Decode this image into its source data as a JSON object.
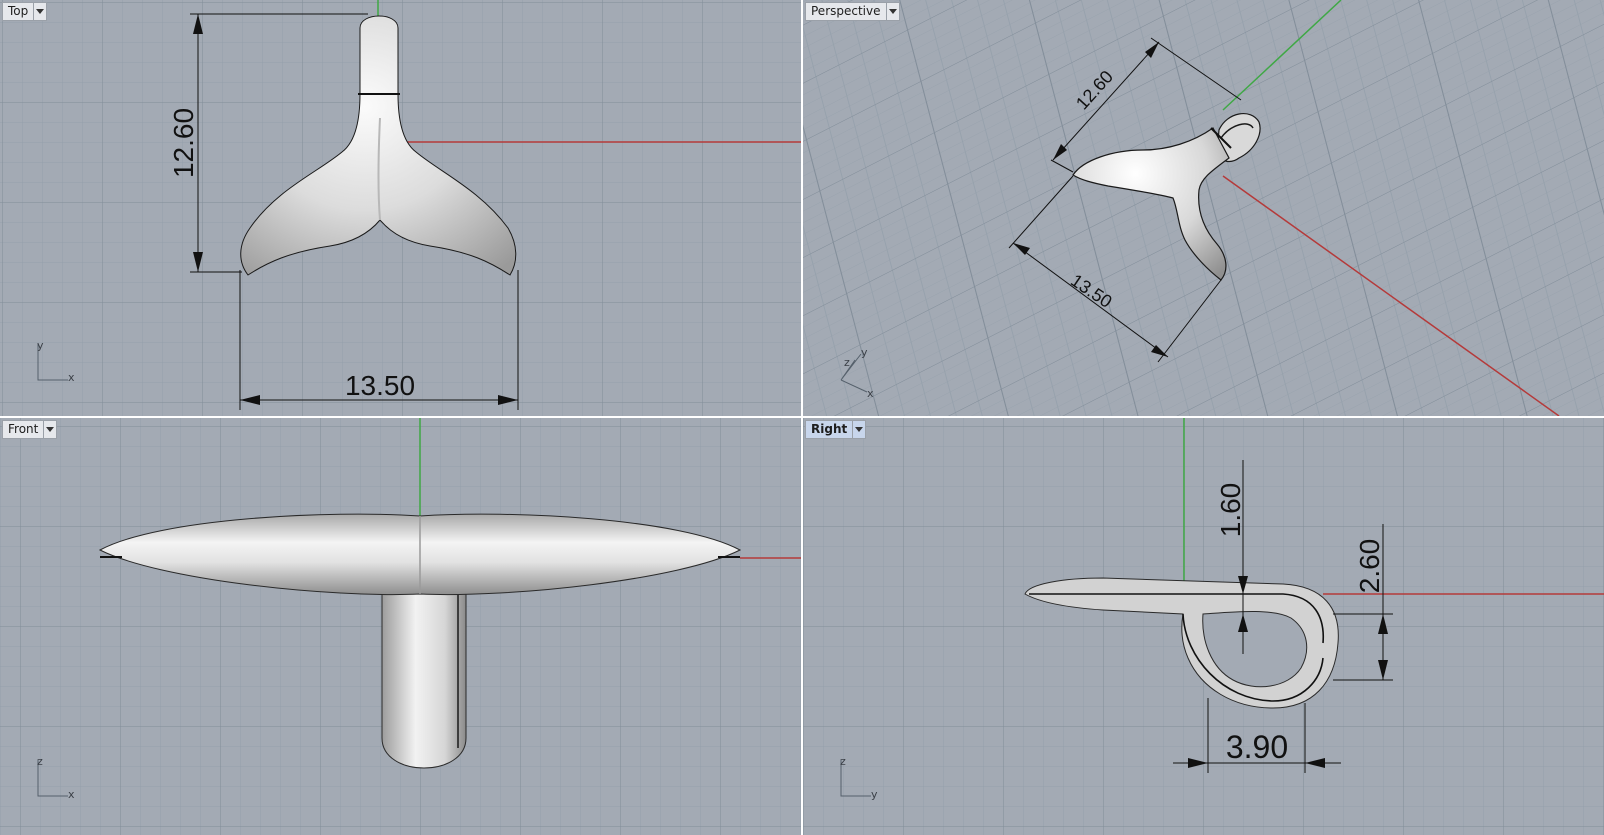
{
  "viewports": {
    "top": {
      "label": "Top",
      "dims": {
        "height": "12.60",
        "width": "13.50"
      },
      "axes": {
        "vertical": "y",
        "horizontal": "x"
      }
    },
    "perspective": {
      "label": "Perspective",
      "dims": {
        "height": "12.60",
        "width": "13.50"
      },
      "axes": {
        "z": "z",
        "y": "y",
        "x": "x"
      }
    },
    "front": {
      "label": "Front",
      "axes": {
        "vertical": "z",
        "horizontal": "x"
      }
    },
    "right": {
      "label": "Right",
      "dims": {
        "a": "1.60",
        "b": "2.60",
        "c": "3.90"
      },
      "axes": {
        "vertical": "z",
        "horizontal": "y"
      }
    }
  },
  "colors": {
    "viewport_bg": "#a3aab4",
    "grid_minor": "#95a0ab",
    "grid_major": "#828d99",
    "x_axis": "#b53a3a",
    "y_axis": "#3fa845",
    "active_tab": "#c8d6ec"
  }
}
